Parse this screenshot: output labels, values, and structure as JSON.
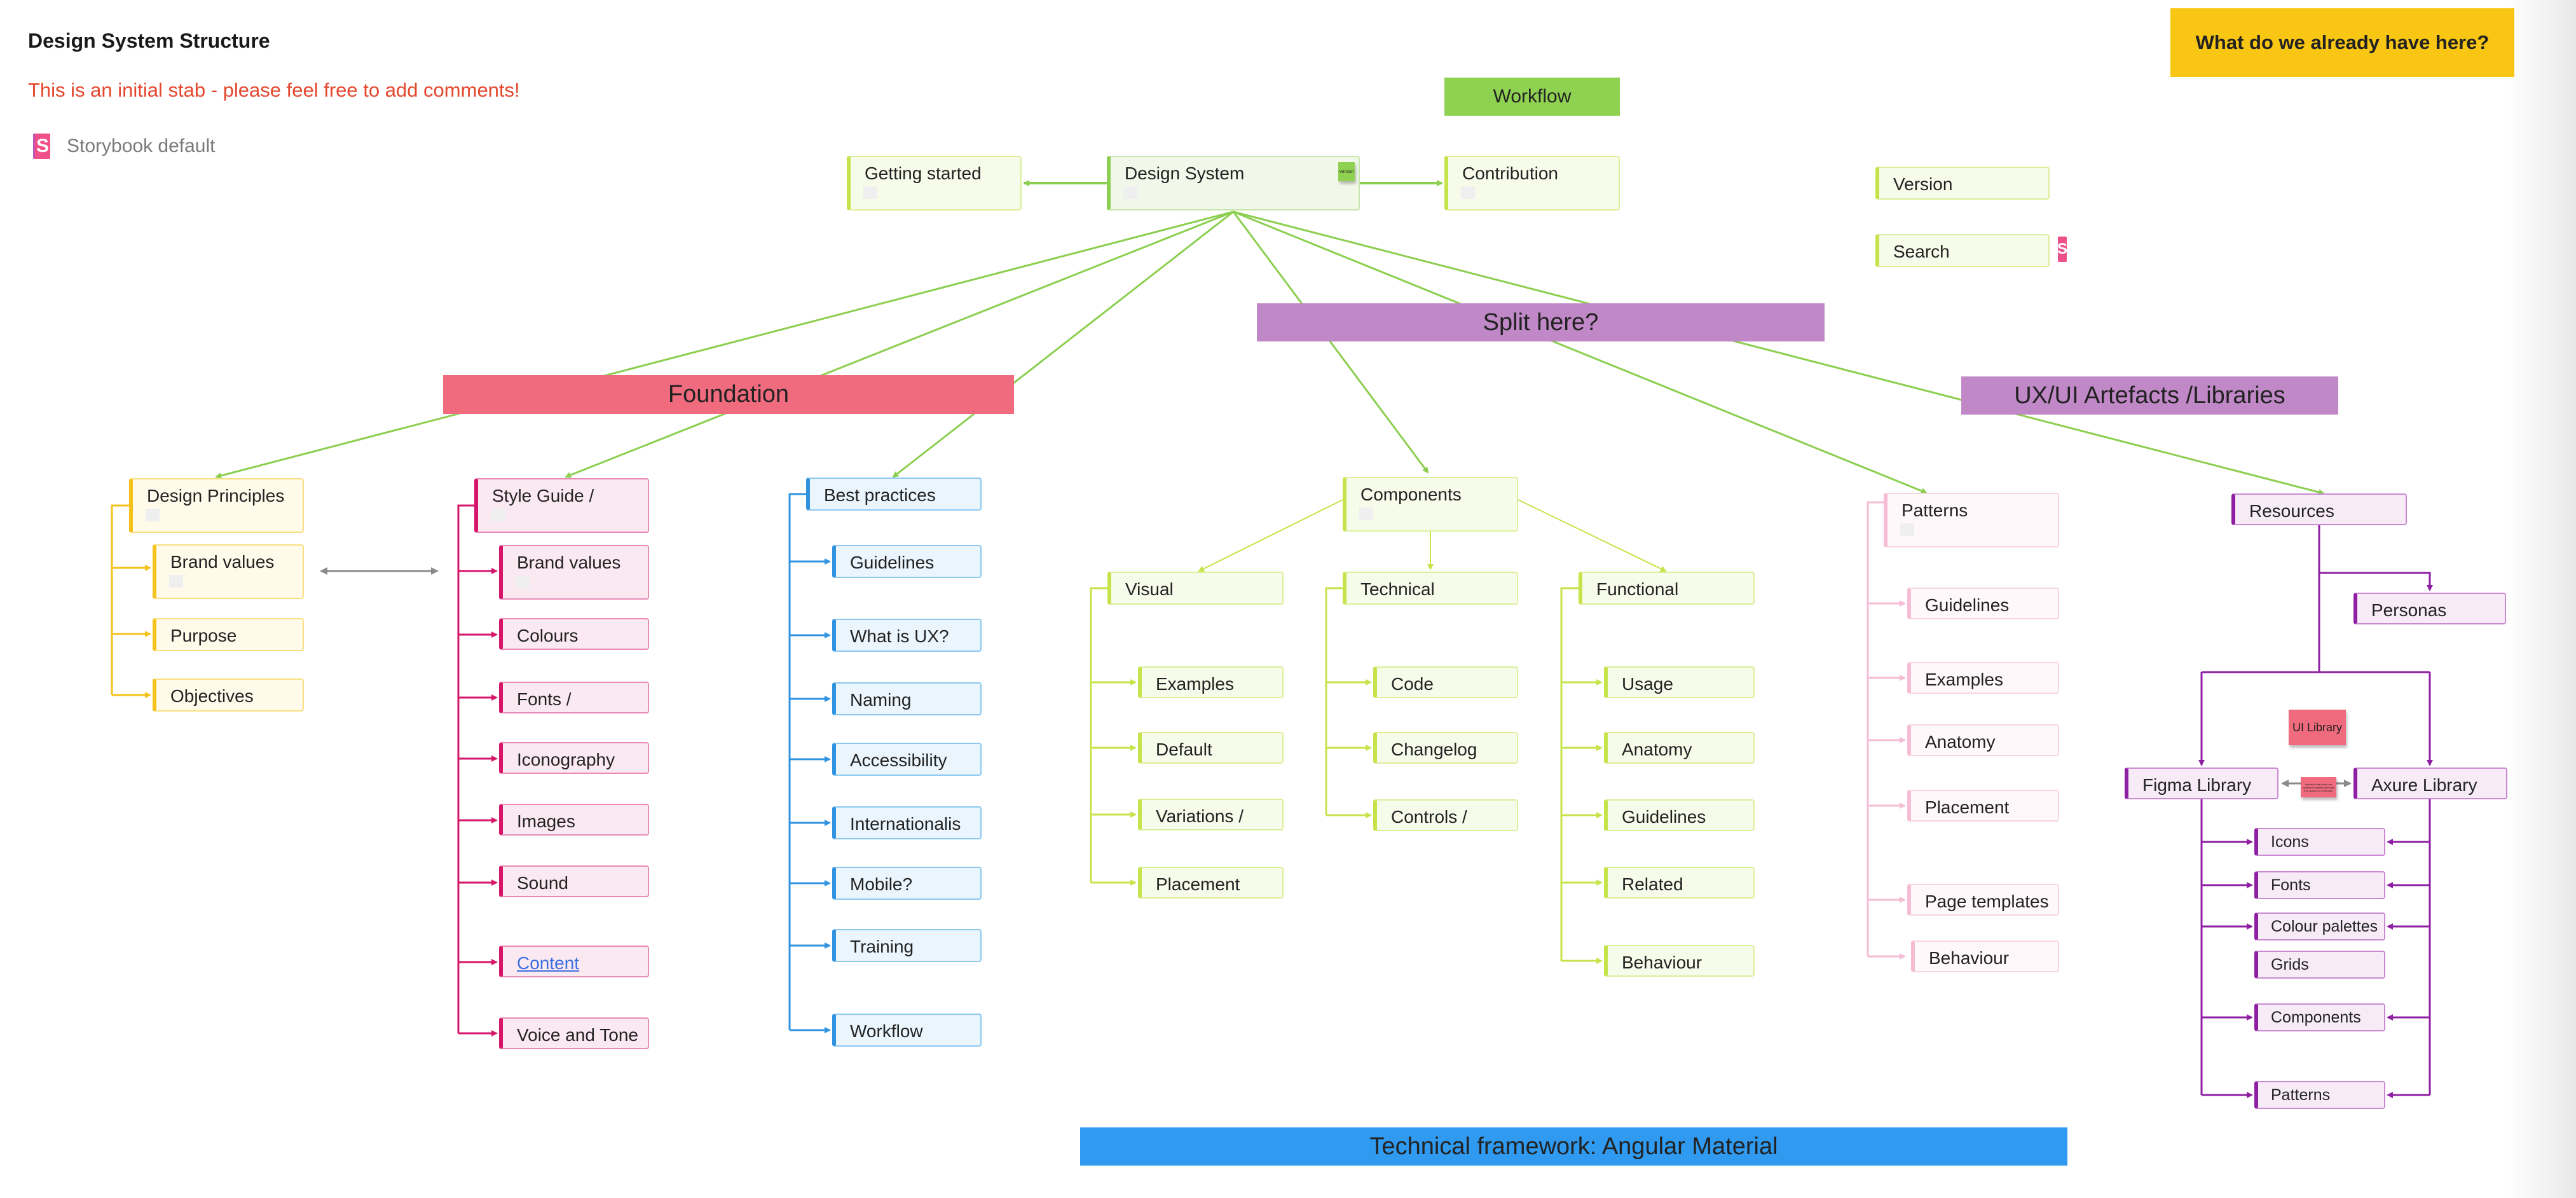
{
  "header": {
    "title": "Design System Structure",
    "note": "This is an initial stab - please feel free to add comments!",
    "storybook_label": "Storybook default",
    "storybook_icon": "storybook-icon"
  },
  "callouts": {
    "question": "What do we already have here?",
    "workflow": "Workflow",
    "split": "Split here?",
    "foundation": "Foundation",
    "artefacts": "UX/UI Artefacts /Libraries",
    "framework": "Technical framework: Angular Material"
  },
  "top_nodes": {
    "getting_started": "Getting started",
    "design_system": "Design System",
    "design_system_sticky": "Version",
    "contribution": "Contribution",
    "version": "Version",
    "search": "Search"
  },
  "design_principles": {
    "title": "Design Principles",
    "items": [
      "Brand values",
      "Purpose",
      "Objectives"
    ]
  },
  "style_guide": {
    "title": "Style Guide /",
    "items": [
      "Brand values",
      "Colours",
      "Fonts /",
      "Iconography",
      "Images",
      "Sound",
      "Content",
      "Voice and Tone"
    ],
    "link_item": "Content"
  },
  "best_practices": {
    "title": "Best practices",
    "items": [
      "Guidelines",
      "What is UX?",
      "Naming",
      "Accessibility",
      "Internationalis",
      "Mobile?",
      "Training",
      "Workflow"
    ]
  },
  "components": {
    "title": "Components",
    "visual": {
      "title": "Visual",
      "items": [
        "Examples",
        "Default",
        "Variations /",
        "Placement"
      ]
    },
    "technical": {
      "title": "Technical",
      "items": [
        "Code",
        "Changelog",
        "Controls /"
      ]
    },
    "functional": {
      "title": "Functional",
      "items": [
        "Usage",
        "Anatomy",
        "Guidelines",
        "Related",
        "Behaviour"
      ]
    }
  },
  "patterns": {
    "title": "Patterns",
    "items": [
      "Guidelines",
      "Examples",
      "Anatomy",
      "Placement",
      "Page templates",
      "Behaviour"
    ]
  },
  "resources": {
    "title": "Resources",
    "personas": "Personas",
    "ui_library_sticky": "UI Library",
    "parallel_sticky": "Important that these are updated in parallel (although this could be a challenge)",
    "figma": "Figma Library",
    "axure": "Axure Library",
    "library_items": [
      "Icons",
      "Fonts",
      "Colour palettes",
      "Grids",
      "Components",
      "Patterns"
    ]
  },
  "colors": {
    "trunk_green": "#8ccf50",
    "lime": "#c6e34a",
    "yellow": "#f5c21a",
    "magenta": "#d6156b",
    "blue": "#2f93e0",
    "light_pink": "#f6bcd4",
    "purple": "#8e1fa3",
    "grey_arrow": "#8a8a8a",
    "foundation_banner": "#f06b7e",
    "split_banner": "#c088c6",
    "framework_banner": "#2f9af0",
    "workflow_banner": "#8fd151",
    "question_banner": "#f8c613",
    "note_red": "#e4472e"
  }
}
